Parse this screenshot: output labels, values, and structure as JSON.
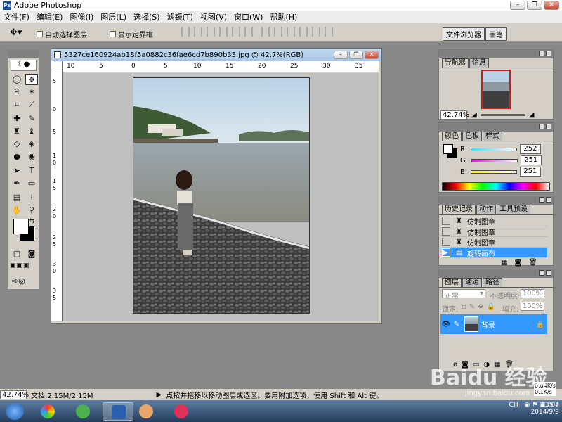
{
  "app": {
    "title": "Adobe Photoshop"
  },
  "menus": [
    "文件(F)",
    "编辑(E)",
    "图像(I)",
    "图层(L)",
    "选择(S)",
    "滤镜(T)",
    "视图(V)",
    "窗口(W)",
    "帮助(H)"
  ],
  "options": {
    "auto_select": "自动选择图层",
    "show_bounds": "显示定界框",
    "file_browser_tab": "文件浏览器",
    "brushes_tab": "画笔"
  },
  "document": {
    "title": "5327ce160924ab18f5a0882c36fae6cd7b890b33.jpg @ 42.7%(RGB)",
    "ruler_h": [
      "10",
      "5",
      "0",
      "5",
      "10",
      "15",
      "20",
      "25",
      "30",
      "35"
    ],
    "ruler_v": [
      "5",
      "0",
      "5",
      "1",
      "0",
      "1",
      "5",
      "2",
      "0",
      "2",
      "5",
      "3",
      "0",
      "3",
      "5",
      "4",
      "0",
      "4",
      "5"
    ]
  },
  "navigator": {
    "tabs": [
      "导航器",
      "信息"
    ],
    "zoom": "42.74%"
  },
  "color_panel": {
    "tabs": [
      "颜色",
      "色板",
      "样式"
    ],
    "r_label": "R",
    "g_label": "G",
    "b_label": "B",
    "r": "252",
    "g": "251",
    "b": "251"
  },
  "history": {
    "tabs": [
      "历史记录",
      "动作",
      "工具预设"
    ],
    "items": [
      "仿制图章",
      "仿制图章",
      "仿制图章",
      "旋转画布"
    ]
  },
  "layers": {
    "tabs": [
      "图层",
      "通道",
      "路径"
    ],
    "blend_mode": "正常",
    "opacity_label": "不透明度:",
    "opacity": "100%",
    "lock_label": "锁定:",
    "fill_label": "填充:",
    "fill": "100%",
    "layer_name": "背景"
  },
  "status": {
    "zoom": "42.74%",
    "doc_info": "文档:2.15M/2.15M",
    "hint": "点按并拖移以移动图层或选区。要用附加选项，使用 Shift 和 Alt 键。"
  },
  "taskbar": {
    "lang": "CH",
    "time": "13:04",
    "date": "2014/9/9",
    "net_up": "0.04K/s",
    "net_down": "0.1K/s"
  },
  "watermark": {
    "brand": "Baidu 经验",
    "url": "jingyan.baidu.com"
  },
  "colors": {
    "accent": "#3399ff",
    "title_bg": "#a9c6e6",
    "panel_bg": "#d4d0c8"
  }
}
